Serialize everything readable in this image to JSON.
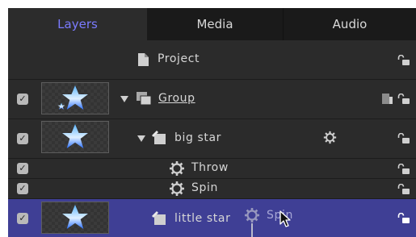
{
  "tabs": [
    {
      "label": "Layers",
      "active": true
    },
    {
      "label": "Media",
      "active": false
    },
    {
      "label": "Audio",
      "active": false
    }
  ],
  "rows": {
    "project": {
      "label": "Project"
    },
    "group": {
      "label": "Group",
      "checked": true
    },
    "big_star": {
      "label": "big star",
      "checked": true
    },
    "throw": {
      "label": "Throw",
      "checked": true
    },
    "spin": {
      "label": "Spin",
      "checked": true
    },
    "little_star": {
      "label": "little star",
      "checked": true,
      "selected": true
    }
  },
  "drag_ghost": {
    "label": "Spin"
  },
  "checkmark": "✓",
  "colors": {
    "panel_bg": "#2b2b2b",
    "tab_bar_bg": "#1a1a1a",
    "active_tab_text": "#7b7bff",
    "selection_bg": "#3f3f95",
    "star_top": "#5ab4ff",
    "star_bottom": "#2a6fff"
  },
  "icons": {
    "project": "document-icon",
    "group": "stacked-layers-icon",
    "layer": "layer-object-icon",
    "behavior": "gear-icon",
    "lock": "unlocked-padlock-icon",
    "cursor": "arrow-cursor-icon"
  }
}
